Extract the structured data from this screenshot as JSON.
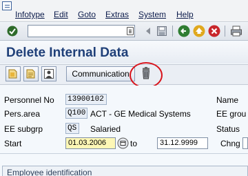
{
  "menubar": {
    "items": [
      {
        "label": "Infotype"
      },
      {
        "label": "Edit"
      },
      {
        "label": "Goto"
      },
      {
        "label": "Extras"
      },
      {
        "label": "System"
      },
      {
        "label": "Help"
      }
    ]
  },
  "toolbar": {
    "command_value": ""
  },
  "page": {
    "title": "Delete Internal Data"
  },
  "app_toolbar": {
    "communication_label": "Communication"
  },
  "form": {
    "personnel_no_label": "Personnel No",
    "personnel_no_value": "13900102",
    "pers_area_label": "Pers.area",
    "pers_area_code": "Q100",
    "pers_area_text": "ACT - GE Medical Systems",
    "ee_subgrp_label": "EE subgrp",
    "ee_subgrp_code": "QS",
    "ee_subgrp_text": "Salaried",
    "start_label": "Start",
    "start_from": "01.03.2006",
    "to_label": "to",
    "start_to": "31.12.9999",
    "name_label": "Name",
    "ee_group_label": "EE grou",
    "status_label": "Status",
    "chng_label": "Chng"
  },
  "groups": {
    "employee_identification": "Employee identification"
  },
  "colors": {
    "title": "#1f3f78",
    "highlight": "#d8141c",
    "start_field": "#fdf7b6"
  }
}
